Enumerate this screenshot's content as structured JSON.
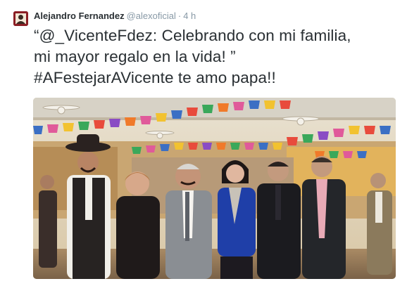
{
  "tweet": {
    "display_name": "Alejandro Fernandez",
    "handle": "@alexoficial",
    "separator": "·",
    "time": "4 h",
    "text_lines": [
      "“@_VicenteFdez: Celebrando con mi familia,",
      "mi mayor regalo en la vida! ”",
      "#AFestejarAVicente te amo papa!!"
    ]
  },
  "icons": {
    "avatar": "profile-avatar-icon"
  },
  "colors": {
    "name": "#292f33",
    "muted": "#8899a6",
    "text": "#292f33",
    "avatar_bg": "#8b1e24"
  }
}
